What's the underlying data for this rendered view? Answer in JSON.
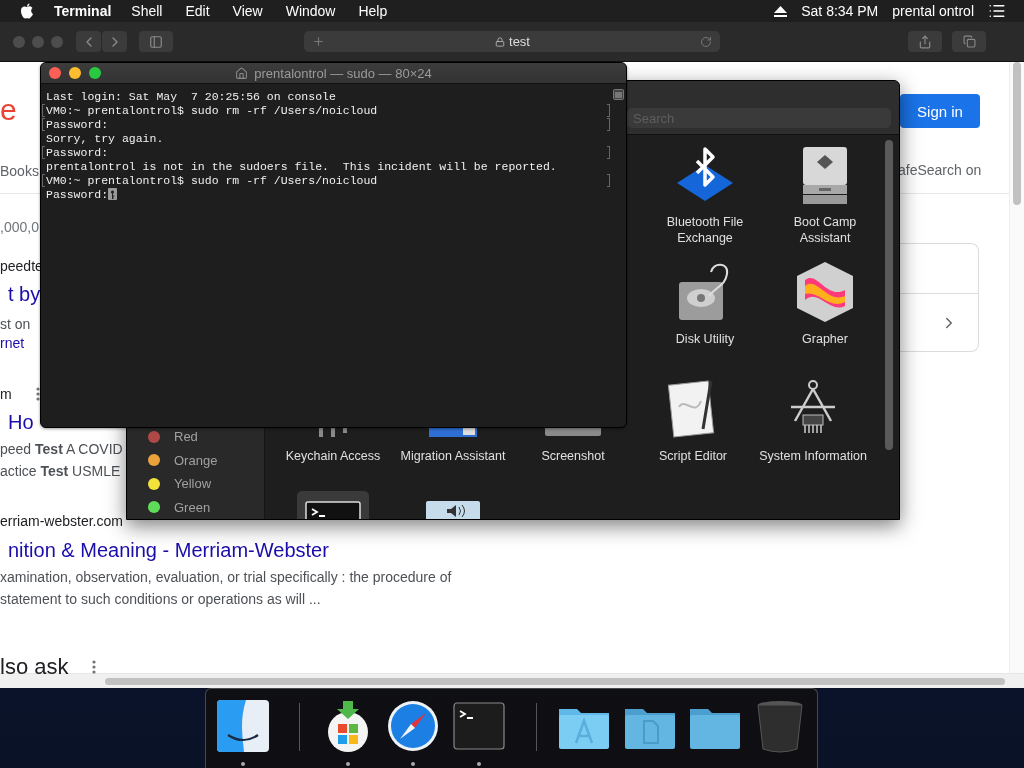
{
  "menu_bar": {
    "app": "Terminal",
    "menus": [
      "Shell",
      "Edit",
      "View",
      "Window",
      "Help"
    ],
    "clock": "Sat 8:34 PM",
    "user": "prental ontrol"
  },
  "browser": {
    "address": "test",
    "left": [
      {
        "kind": "logo",
        "text": "e"
      },
      {
        "kind": "tab",
        "text": "Books"
      },
      {
        "kind": "meta",
        "text": ",000,0"
      },
      {
        "kind": "site",
        "text": "peedte"
      },
      {
        "kind": "title",
        "text": "t by"
      },
      {
        "kind": "snippet",
        "text": "st on"
      },
      {
        "kind": "link",
        "text": "rnet"
      },
      {
        "kind": "site_menu",
        "text": "m"
      },
      {
        "kind": "title",
        "text": "Ho"
      },
      {
        "kind": "snippet",
        "text": "peed **Test** A COVID"
      },
      {
        "kind": "snippet",
        "text": "actice **Test** USMLE"
      },
      {
        "kind": "site",
        "text": "erriam-webster.com"
      },
      {
        "kind": "title",
        "text": "nition & Meaning - Merriam-Webster"
      },
      {
        "kind": "snippet",
        "text": "xamination, observation, evaluation, or trial specifically : the procedure of"
      },
      {
        "kind": "snippet",
        "text": "statement to such conditions or operations as will ..."
      },
      {
        "kind": "heading_menu",
        "text": "lso ask"
      }
    ],
    "sign_in": "Sign in",
    "safesearch": "afeSearch on"
  },
  "finder": {
    "search_placeholder": "Search",
    "tags": [
      {
        "label": "Red",
        "color": "#b04848"
      },
      {
        "label": "Orange",
        "color": "#eaa23c"
      },
      {
        "label": "Yellow",
        "color": "#f2e23a"
      },
      {
        "label": "Green",
        "color": "#5fdc5a"
      }
    ],
    "rows": [
      [
        {
          "kind": "bluetooth",
          "label": "Bluetooth File Exchange"
        },
        {
          "kind": "drive",
          "label": "Boot Camp Assistant"
        }
      ],
      [
        {
          "kind": "disk",
          "label": "Disk Utility"
        },
        {
          "kind": "cube",
          "label": "Grapher"
        }
      ],
      [
        {
          "kind": "key",
          "label": "Keychain Access"
        },
        {
          "kind": "computer",
          "label": "Migration Assistant"
        },
        {
          "kind": "camera",
          "label": "Screenshot"
        },
        {
          "kind": "document",
          "label": "Script Editor"
        },
        {
          "kind": "caliper",
          "label": "System Information"
        }
      ],
      [
        {
          "kind": "terminal",
          "selected": true
        },
        {
          "kind": "speaker",
          "selected": false
        }
      ]
    ]
  },
  "terminal": {
    "title": "prentalontrol — sudo — 80×24",
    "lines": [
      {
        "kind": "plain",
        "text": "Last login: Sat May  7 20:25:56 on console"
      },
      {
        "kind": "marked",
        "text": "VM0:~ prentalontrol$ sudo rm -rf /Users/noicloud"
      },
      {
        "kind": "marked",
        "text": "Password:"
      },
      {
        "kind": "plain",
        "text": "Sorry, try again."
      },
      {
        "kind": "marked",
        "text": "Password:"
      },
      {
        "kind": "plain",
        "text": "prentalontrol is not in the sudoers file.  This incident will be reported."
      },
      {
        "kind": "marked",
        "text": "VM0:~ prentalontrol$ sudo rm -rf /Users/noicloud"
      },
      {
        "kind": "input",
        "text": "Password:"
      }
    ]
  },
  "dock": {
    "sections": [
      [
        {
          "kind": "finder",
          "running": true
        }
      ],
      [
        {
          "kind": "installer",
          "running": true
        },
        {
          "kind": "compass",
          "running": true
        },
        {
          "kind": "terminal",
          "running": true
        }
      ],
      [
        {
          "kind": "apps_folder",
          "running": false
        },
        {
          "kind": "docs_folder",
          "running": false
        },
        {
          "kind": "folder",
          "running": false
        },
        {
          "kind": "trash",
          "running": false
        }
      ]
    ]
  }
}
